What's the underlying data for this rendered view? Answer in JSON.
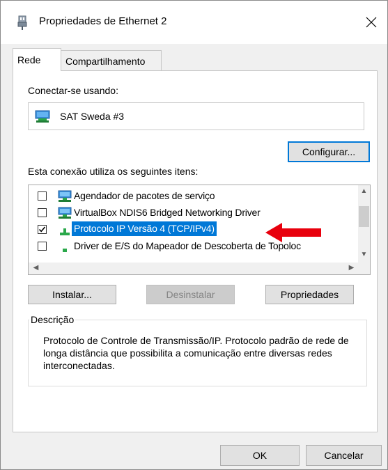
{
  "window": {
    "title": "Propriedades de Ethernet 2",
    "close_glyph": "✕"
  },
  "tabs": [
    {
      "label": "Rede",
      "active": true
    },
    {
      "label": "Compartilhamento",
      "active": false
    }
  ],
  "connect": {
    "label": "Conectar-se usando:",
    "adapter": "SAT Sweda #3",
    "adapter_icon": "network-adapter-icon"
  },
  "buttons": {
    "configure": "Configurar...",
    "install": "Instalar...",
    "uninstall": "Desinstalar",
    "properties": "Propriedades",
    "ok": "OK",
    "cancel": "Cancelar"
  },
  "items_label": "Esta conexão utiliza os seguintes itens:",
  "items": [
    {
      "label": "Agendador de pacotes de serviço",
      "checked": false,
      "icon": "network-service-icon",
      "selected": false
    },
    {
      "label": "VirtualBox NDIS6 Bridged Networking Driver",
      "checked": false,
      "icon": "network-service-icon",
      "selected": false
    },
    {
      "label": "Protocolo IP Versão 4 (TCP/IPv4)",
      "checked": true,
      "icon": "protocol-icon",
      "selected": true
    },
    {
      "label": "Driver de E/S do Mapeador de Descoberta de Topoloc",
      "checked": false,
      "icon": "protocol-icon",
      "selected": false
    }
  ],
  "description": {
    "title": "Descrição",
    "text": "Protocolo de Controle de Transmissão/IP. Protocolo padrão de rede de longa distância que possibilita a comunicação entre diversas redes interconectadas."
  },
  "colors": {
    "selection": "#0078d7",
    "annotation_arrow": "#e8000d",
    "focus_border": "#0078d7"
  }
}
